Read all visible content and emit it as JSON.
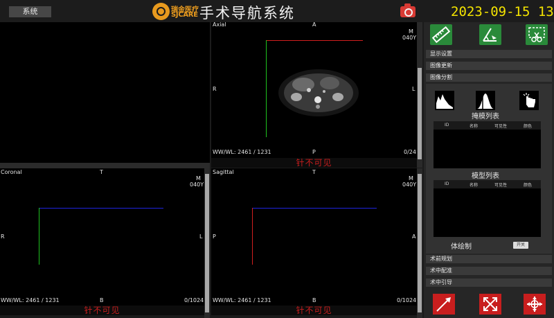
{
  "topbar": {
    "system_button": "系统",
    "logo_cn": "瑞金医疗",
    "logo_en": "SJCARE",
    "title": "手术导航系统",
    "clock": "2023-09-15 13:"
  },
  "viewports": {
    "axial": {
      "name": "Axial",
      "top_marker": "A",
      "bottom_marker": "P",
      "left_marker": "R",
      "right_marker": "L",
      "corner_m": "M",
      "age": "040Y",
      "wwwl": "WW/WL: 2461 / 1231",
      "slice": "0/24",
      "footer": "针不可见"
    },
    "coronal": {
      "name": "Coronal",
      "top_marker": "T",
      "bottom_marker": "B",
      "left_marker": "R",
      "right_marker": "L",
      "corner_m": "M",
      "age": "040Y",
      "wwwl": "WW/WL: 2461 / 1231",
      "slice": "0/1024",
      "footer": "针不可见"
    },
    "sagittal": {
      "name": "Sagittal",
      "top_marker": "T",
      "bottom_marker": "B",
      "left_marker": "P",
      "right_marker": "A",
      "corner_m": "M",
      "age": "040Y",
      "wwwl": "WW/WL: 2461 / 1231",
      "slice": "0/1024",
      "footer": "针不可见"
    }
  },
  "panel": {
    "tools": [
      "ruler-icon",
      "angle-measure-icon",
      "cut-selection-icon"
    ],
    "menu": {
      "display_settings": "显示设置",
      "image_update": "图像更新",
      "image_segmentation": "图像分割",
      "preop_planning": "术前规划",
      "intraop_registration": "术中配准",
      "intraop_guidance": "术中引导"
    },
    "segmentation": {
      "mask_list_title": "掩模列表",
      "model_list_title": "模型列表",
      "columns": [
        "ID",
        "名称",
        "可见性",
        "颜色"
      ],
      "volume_render_label": "体绘制",
      "volume_render_switch": "开关"
    },
    "bottom_tools": [
      "needle-icon",
      "expand-arrows-icon",
      "crosshair-arrows-icon"
    ]
  },
  "colors": {
    "accent_green": "#2a8a3a",
    "accent_red": "#c81e1e",
    "clock_yellow": "#f4e400",
    "logo_orange": "#e89a1e"
  }
}
